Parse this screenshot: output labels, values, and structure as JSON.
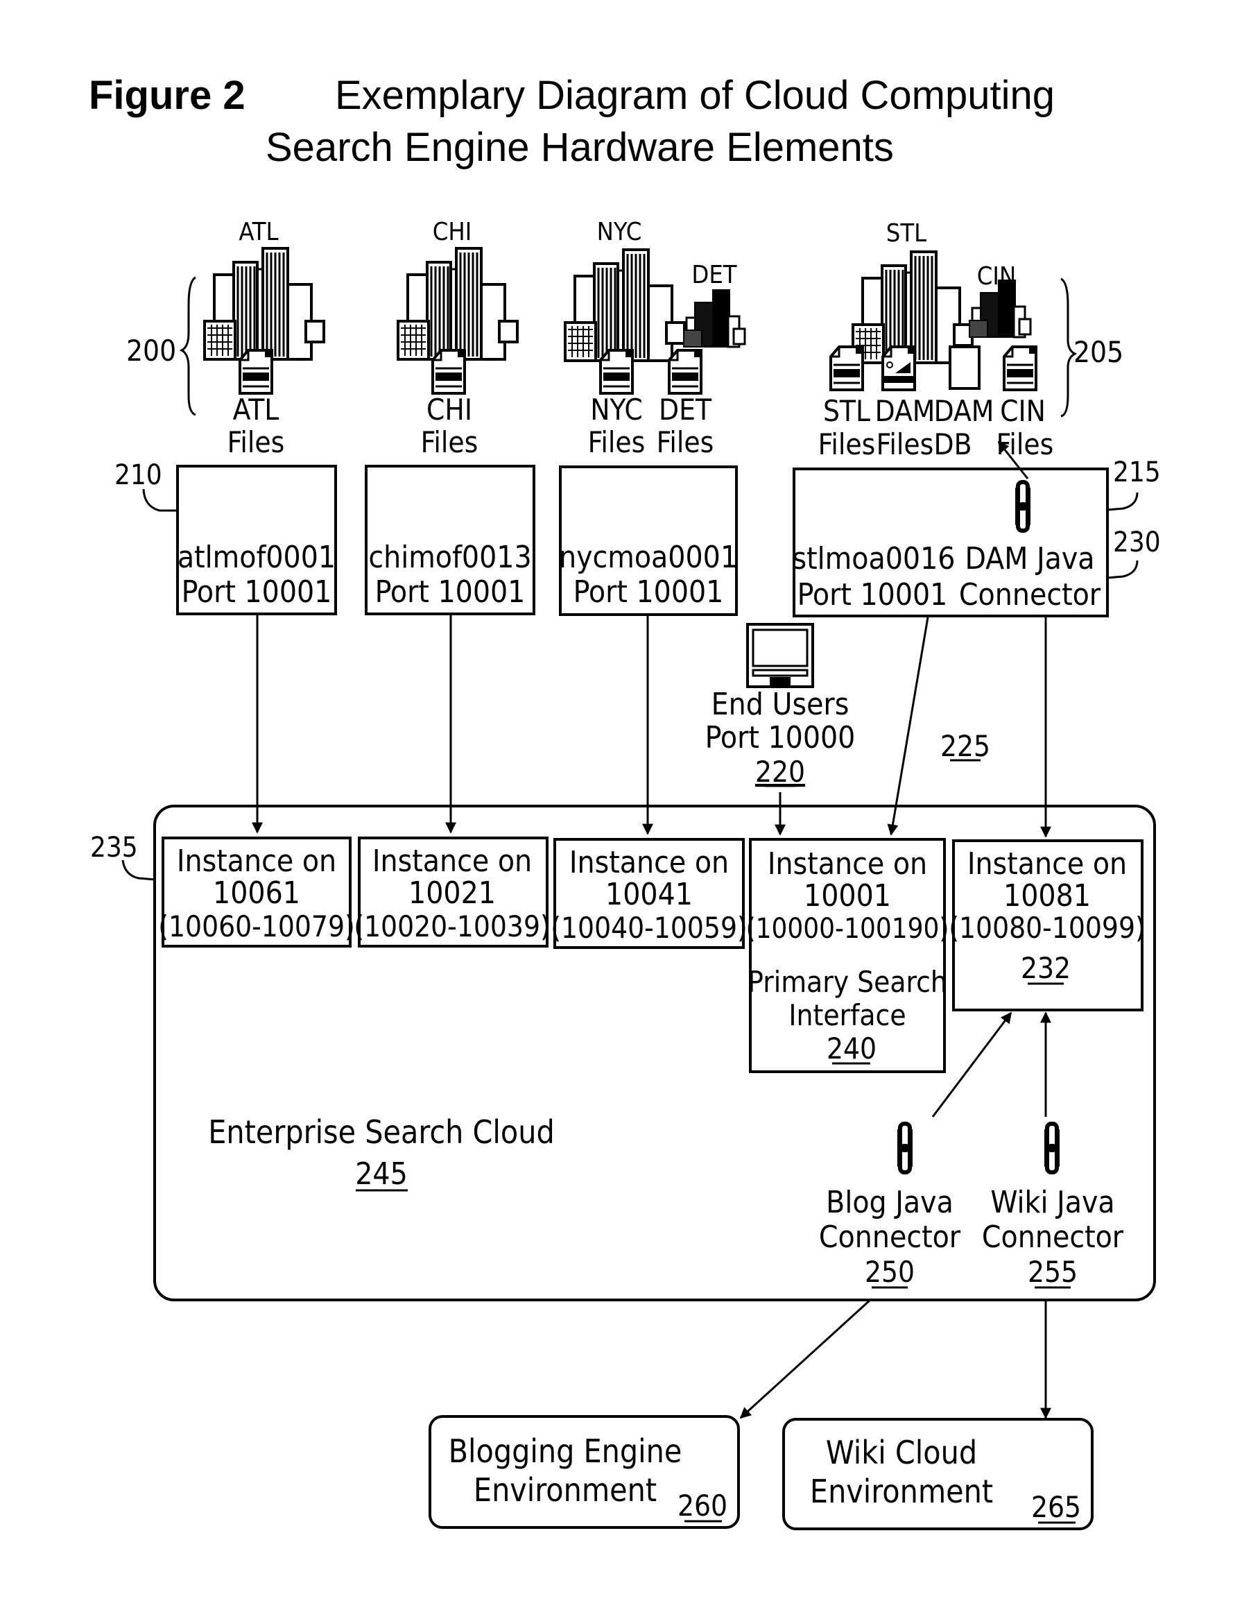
{
  "title": {
    "figure_label": "Figure 2",
    "line1": "Exemplary Diagram of Cloud Computing",
    "line2": "Search Engine Hardware Elements"
  },
  "groups": {
    "left_ref": "200",
    "right_ref": "205"
  },
  "cities": [
    {
      "id": "atl",
      "label": "ATL",
      "size": "large"
    },
    {
      "id": "chi",
      "label": "CHI",
      "size": "large"
    },
    {
      "id": "nyc",
      "label": "NYC",
      "size": "large"
    },
    {
      "id": "det",
      "label": "DET",
      "size": "small"
    },
    {
      "id": "stl",
      "label": "STL",
      "size": "large"
    },
    {
      "id": "cin",
      "label": "CIN",
      "size": "small"
    }
  ],
  "files": [
    {
      "id": "atl",
      "line1": "ATL",
      "line2": "Files",
      "icon": "document-icon"
    },
    {
      "id": "chi",
      "line1": "CHI",
      "line2": "Files",
      "icon": "document-icon"
    },
    {
      "id": "nyc",
      "line1": "NYC",
      "line2": "Files",
      "icon": "document-icon"
    },
    {
      "id": "det",
      "line1": "DET",
      "line2": "Files",
      "icon": "document-icon"
    },
    {
      "id": "stl",
      "line1": "STL",
      "line2": "Files",
      "icon": "document-icon"
    },
    {
      "id": "dam-files",
      "line1": "DAM",
      "line2": "Files",
      "icon": "image-document-icon"
    },
    {
      "id": "dam-db",
      "line1": "DAM",
      "line2": "DB",
      "icon": "blank-page-icon"
    },
    {
      "id": "cin",
      "line1": "CIN",
      "line2": "Files",
      "icon": "document-icon"
    }
  ],
  "servers": [
    {
      "id": "atl",
      "host": "atlmof0001",
      "port": "Port 10001"
    },
    {
      "id": "chi",
      "host": "chimof0013",
      "port": "Port 10001"
    },
    {
      "id": "nyc",
      "host": "nycmoa0001",
      "port": "Port 10001"
    },
    {
      "id": "stl",
      "host": "stlmoa0016",
      "port": "Port 10001"
    }
  ],
  "dam_connector": {
    "line1": "DAM Java",
    "line2": "Connector"
  },
  "refs": {
    "r210": "210",
    "r215": "215",
    "r230": "230",
    "r225": "225",
    "r235": "235"
  },
  "end_users": {
    "line1": "End Users",
    "line2": "Port 10000",
    "ref": "220"
  },
  "instances": [
    {
      "line1": "Instance on",
      "port": "10061",
      "range": "(10060-10079)"
    },
    {
      "line1": "Instance on",
      "port": "10021",
      "range": "(10020-10039)"
    },
    {
      "line1": "Instance on",
      "port": "10041",
      "range": "(10040-10059)"
    },
    {
      "line1": "Instance on",
      "port": "10001",
      "range": "(10000-100190)",
      "sub1": "Primary Search",
      "sub2": "Interface",
      "ref": "240"
    },
    {
      "line1": "Instance on",
      "port": "10081",
      "range": "(10080-10099)",
      "ref": "232"
    }
  ],
  "cloud": {
    "label": "Enterprise Search Cloud",
    "ref": "245"
  },
  "connectors": [
    {
      "line1": "Blog Java",
      "line2": "Connector",
      "ref": "250"
    },
    {
      "line1": "Wiki Java",
      "line2": "Connector",
      "ref": "255"
    }
  ],
  "environments": [
    {
      "line1": "Blogging Engine",
      "line2": "Environment",
      "ref": "260"
    },
    {
      "line1": "Wiki Cloud",
      "line2": "Environment",
      "ref": "265"
    }
  ]
}
